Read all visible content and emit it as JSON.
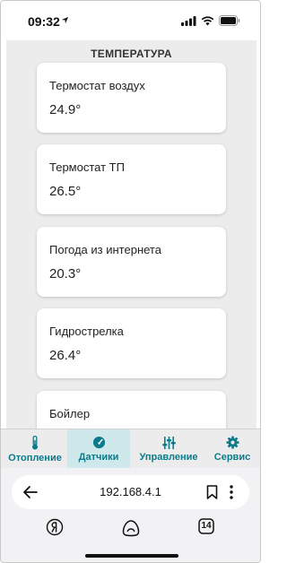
{
  "status_bar": {
    "time": "09:32",
    "icons": [
      "location-arrow-icon",
      "signal-icon",
      "wifi-icon",
      "battery-icon"
    ]
  },
  "section": {
    "title": "ТЕМПЕРАТУРА"
  },
  "cards": [
    {
      "label": "Термостат воздух",
      "value": "24.9°"
    },
    {
      "label": "Термостат ТП",
      "value": "26.5°"
    },
    {
      "label": "Погода из интернета",
      "value": "20.3°"
    },
    {
      "label": "Гидрострелка",
      "value": "26.4°"
    },
    {
      "label": "Бойлер",
      "value": ""
    }
  ],
  "nav": {
    "items": [
      {
        "label": "Отопление",
        "icon": "thermometer-icon",
        "active": false
      },
      {
        "label": "Датчики",
        "icon": "gauge-icon",
        "active": true
      },
      {
        "label": "Управление",
        "icon": "sliders-icon",
        "active": false
      },
      {
        "label": "Сервис",
        "icon": "gear-icon",
        "active": false
      }
    ],
    "accent_color": "#0b7b8b",
    "active_bg": "#cfe8ec"
  },
  "browser": {
    "url": "192.168.4.1",
    "tabs_count": "14",
    "tool_icons": [
      "yandex-icon",
      "alice-icon",
      "tabs-icon"
    ]
  }
}
